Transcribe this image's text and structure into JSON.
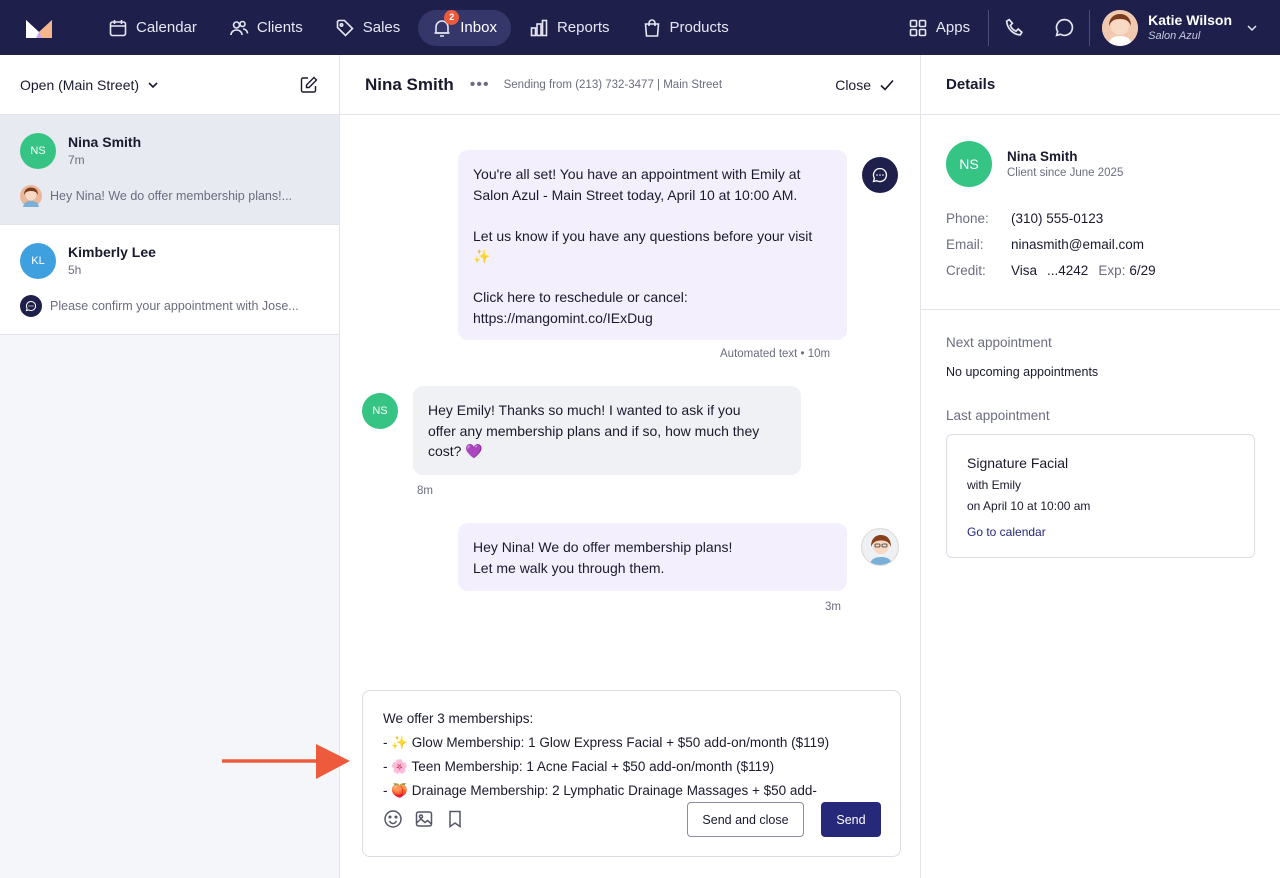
{
  "nav": {
    "items": [
      {
        "label": "Calendar",
        "icon": "calendar-icon"
      },
      {
        "label": "Clients",
        "icon": "users-icon"
      },
      {
        "label": "Sales",
        "icon": "tag-icon"
      },
      {
        "label": "Inbox",
        "icon": "inbox-icon",
        "badge": "2"
      },
      {
        "label": "Reports",
        "icon": "bar-chart-icon"
      },
      {
        "label": "Products",
        "icon": "shopping-bag-icon"
      }
    ],
    "apps_label": "Apps",
    "user_name": "Katie Wilson",
    "user_location": "Salon Azul"
  },
  "left": {
    "filter_label": "Open (Main Street)",
    "conversations": [
      {
        "initials": "NS",
        "name": "Nina Smith",
        "time": "7m",
        "preview": "Hey Nina! We do offer membership plans!..."
      },
      {
        "initials": "KL",
        "name": "Kimberly Lee",
        "time": "5h",
        "preview": "Please confirm your appointment with Jose..."
      }
    ]
  },
  "center": {
    "contact_name": "Nina Smith",
    "more": "•••",
    "sending_from": "Sending from (213) 732-3477 | Main Street",
    "close_label": "Close",
    "messages": [
      {
        "lines": [
          "You're all set! You have an appointment with Emily at",
          "Salon Azul - Main Street today, April 10 at 10:00 AM.",
          "",
          "Let us know if you have any questions before your visit",
          "✨",
          "",
          "Click here to reschedule or cancel:",
          "https://mangomint.co/IExDug"
        ],
        "meta": "Automated text • 10m"
      },
      {
        "initials": "NS",
        "lines": [
          "Hey Emily! Thanks so much! I wanted to ask if you",
          "offer any membership plans and if so, how much they",
          "cost? 💜"
        ],
        "meta": "8m"
      },
      {
        "lines": [
          "Hey Nina! We do offer membership plans!",
          "Let me walk you through them."
        ],
        "meta": "3m"
      }
    ],
    "composer": {
      "lines": [
        "We offer 3 memberships:",
        "- ✨ Glow Membership: 1 Glow Express Facial + $50 add-on/month ($119)",
        "- 🌸 Teen Membership: 1 Acne Facial + $50 add-on/month ($119)",
        "- 🍑 Drainage Membership: 2 Lymphatic Drainage Massages  + $50 add-"
      ],
      "send_close_label": "Send and close",
      "send_label": "Send"
    }
  },
  "right": {
    "title": "Details",
    "client_initials": "NS",
    "client_name": "Nina Smith",
    "client_since": "Client since June 2025",
    "phone_label": "Phone:",
    "phone": "(310) 555-0123",
    "email_label": "Email:",
    "email": "ninasmith@email.com",
    "credit_label": "Credit:",
    "card_brand": "Visa",
    "card_last4": "...4242",
    "exp_label": "Exp:",
    "exp_value": "6/29",
    "next_label": "Next appointment",
    "next_value": "No upcoming appointments",
    "last_label": "Last appointment",
    "last_appt": {
      "service": "Signature Facial",
      "staff": "with Emily",
      "when": "on April 10 at 10:00 am",
      "link": "Go to calendar"
    }
  },
  "colors": {
    "nav_bg": "#1e1f4b",
    "accent": "#26287a",
    "arrow": "#ee5a3c",
    "ns_green": "#36c485",
    "kl_blue": "#3fa0e0"
  }
}
